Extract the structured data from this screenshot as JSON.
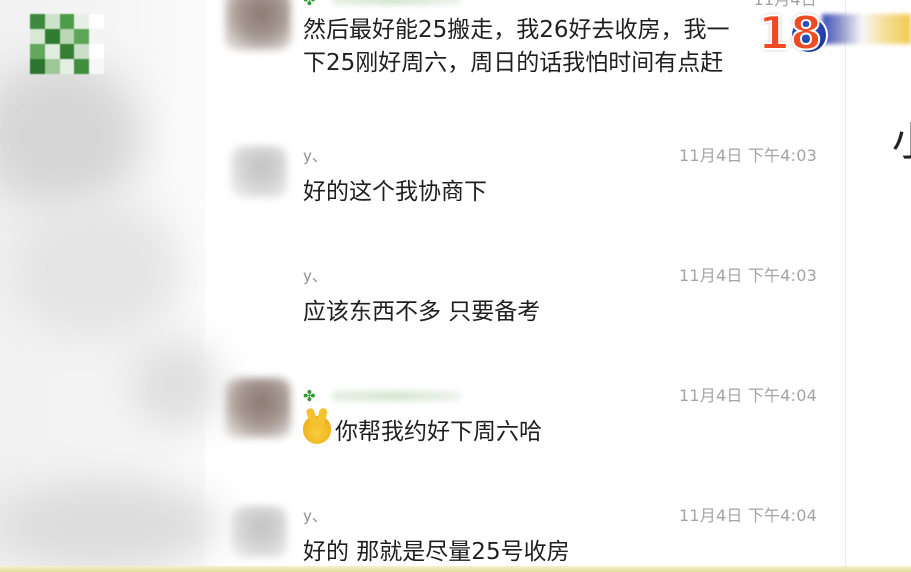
{
  "messages": [
    {
      "sender": "",
      "time": "11月4日",
      "lines": [
        "然后最好能25搬走，我26好去收房，我一",
        "下25刚好周六，周日的话我怕时间有点赶"
      ]
    },
    {
      "sender": "y、",
      "time": "11月4日 下午4:03",
      "lines": [
        "好的这个我协商下"
      ]
    },
    {
      "sender": "y、",
      "time": "11月4日 下午4:03",
      "lines": [
        "应该东西不多 只要备考"
      ]
    },
    {
      "sender": "",
      "time": "11月4日 下午4:04",
      "lines": [
        "你帮我约好下周六哈"
      ]
    },
    {
      "sender": "y、",
      "time": "11月4日 下午4:04",
      "lines": [
        "好的 那就是尽量25号收房"
      ]
    }
  ],
  "channel_logo": {
    "text": "18"
  },
  "icons": {
    "clover": "four-leaf-clover-icon",
    "victory": "victory-hand-emoji"
  },
  "colors": {
    "accent_green": "#3a9a38",
    "logo_orange": "#f04a23",
    "logo_blue": "#142b8e"
  }
}
